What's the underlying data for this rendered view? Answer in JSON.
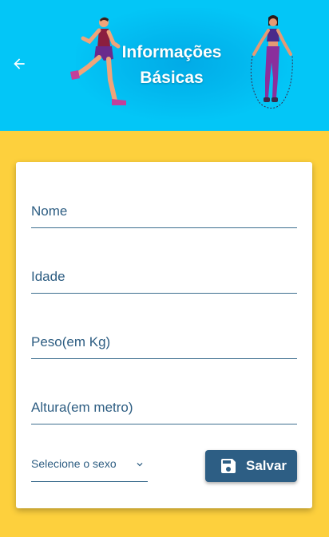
{
  "header": {
    "title_line1": "Informações",
    "title_line2": "Básicas",
    "back_icon": "arrow-left-icon",
    "background_color": "#03c6f7"
  },
  "form": {
    "fields": [
      {
        "label": "Nome"
      },
      {
        "label": "Idade"
      },
      {
        "label": "Peso(em Kg)"
      },
      {
        "label": "Altura(em metro)"
      }
    ],
    "gender_select": {
      "placeholder": "Selecione o sexo",
      "icon": "chevron-down-icon"
    },
    "save_button": {
      "label": "Salvar",
      "icon": "floppy-disk-icon",
      "color": "#2d5e84"
    }
  },
  "colors": {
    "page_background": "#fdd03d",
    "accent": "#2d5d82"
  }
}
